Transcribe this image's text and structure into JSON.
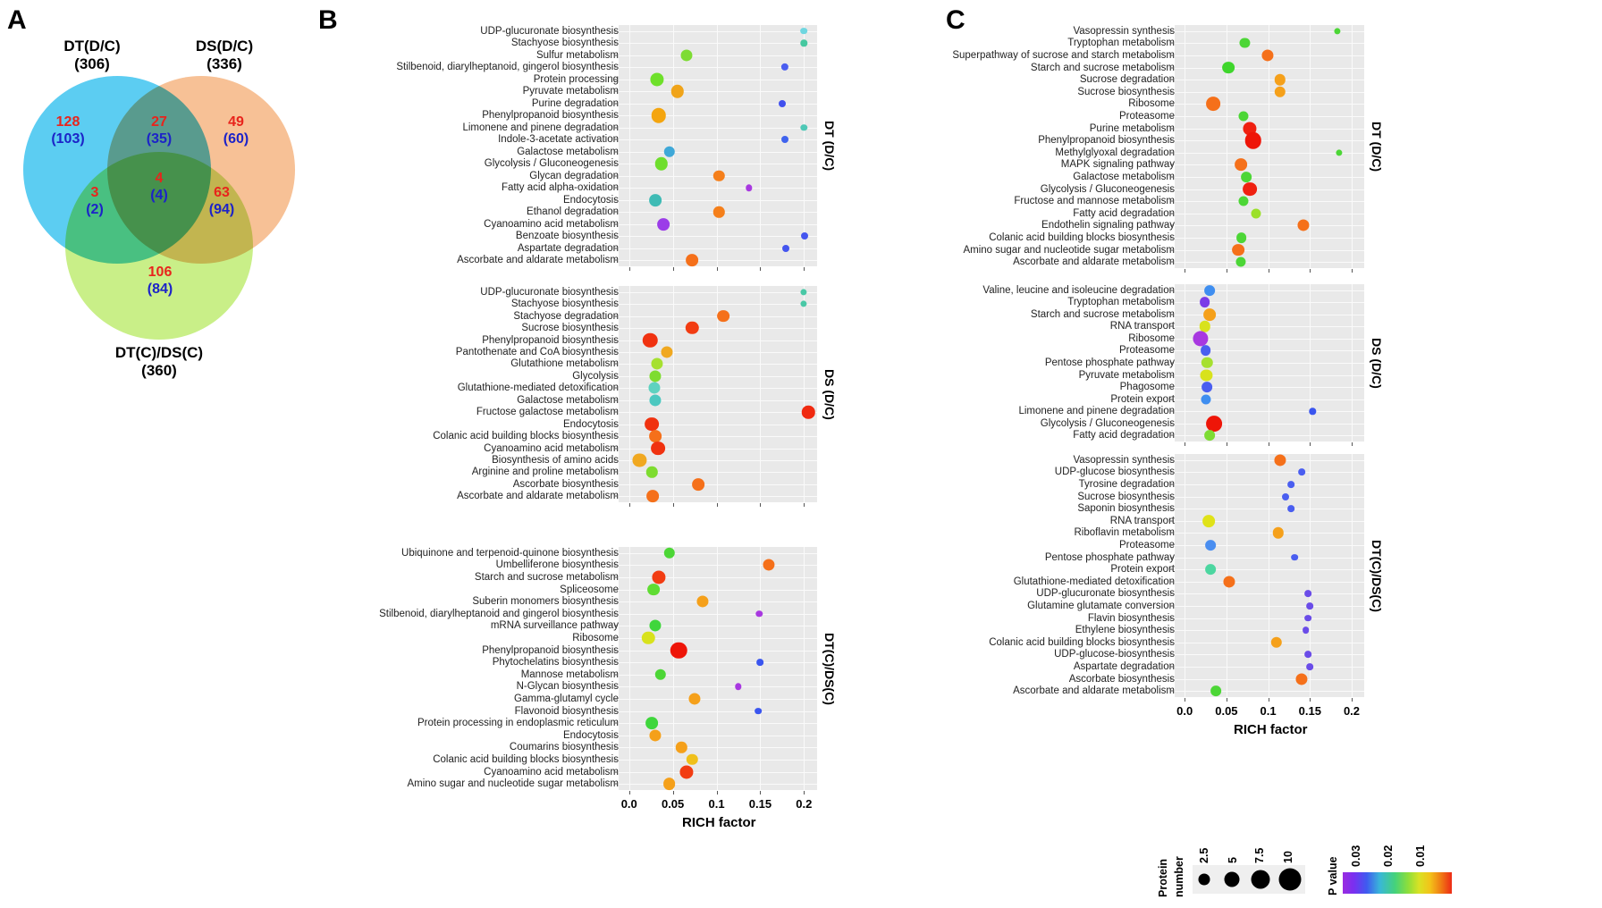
{
  "panels": {
    "a": "A",
    "b": "B",
    "c": "C"
  },
  "venn": {
    "sets": [
      {
        "name": "DT(D/C)",
        "count": "(306)",
        "color": "#5ccdf2"
      },
      {
        "name": "DS(D/C)",
        "count": "(336)",
        "color": "#f7c196"
      },
      {
        "name": "DT(C)/DS(C)",
        "count": "(360)",
        "color": "#c9ef88"
      }
    ],
    "regions": [
      {
        "id": "dt-only",
        "up": "128",
        "down": "(103)"
      },
      {
        "id": "dt-ds",
        "up": "27",
        "down": "(35)"
      },
      {
        "id": "ds-only",
        "up": "49",
        "down": "(60)"
      },
      {
        "id": "dt-dtds",
        "up": "3",
        "down": "(2)"
      },
      {
        "id": "center",
        "up": "4",
        "down": "(4)"
      },
      {
        "id": "ds-dtds",
        "up": "63",
        "down": "(94)"
      },
      {
        "id": "dtds-only",
        "up": "106",
        "down": "(84)"
      }
    ]
  },
  "axis": {
    "x_title": "RICH factor"
  },
  "legend": {
    "size_title_1": "Protein",
    "size_title_2": "number",
    "size_values": [
      "2.5",
      "5",
      "7.5",
      "10"
    ],
    "pvalue_title": "P value",
    "pvalue_ticks": [
      "0.03",
      "0.02",
      "0.01"
    ]
  },
  "chart_data": [
    {
      "id": "B-DT",
      "type": "scatter",
      "panel": "B",
      "strip": "DT (D/C)",
      "xlabel": "RICH factor",
      "xlim": [
        -0.012,
        0.215
      ],
      "xticks": [
        0.0,
        0.05,
        0.1,
        0.15,
        0.2
      ],
      "xticklabels": [
        "0.0",
        "0.05",
        "0.1",
        "0.15",
        "0.2"
      ],
      "grid": true,
      "categories": [
        "UDP-glucuronate biosynthesis",
        "Stachyose biosynthesis",
        "Sulfur metabolism",
        "Stilbenoid, diarylheptanoid, gingerol biosynthesis",
        "Protein processing",
        "Pyruvate metabolism",
        "Purine degradation",
        "Phenylpropanoid biosynthesis",
        "Limonene and pinene degradation",
        "Indole-3-acetate activation",
        "Galactose metabolism",
        "Glycolysis / Gluconeogenesis",
        "Glycan degradation",
        "Fatty acid alpha-oxidation",
        "Endocytosis",
        "Ethanol degradation",
        "Cyanoamino acid metabolism",
        "Benzoate biosynthesis",
        "Aspartate degradation",
        "Ascorbate and aldarate metabolism"
      ],
      "points": [
        {
          "x": 0.2,
          "size": 2.0,
          "color": "#6fd6e0"
        },
        {
          "x": 0.2,
          "size": 1.8,
          "color": "#46c8a0"
        },
        {
          "x": 0.066,
          "size": 6.0,
          "color": "#7ddc33"
        },
        {
          "x": 0.178,
          "size": 2.4,
          "color": "#4a5ef0"
        },
        {
          "x": 0.032,
          "size": 7.5,
          "color": "#6ee02a"
        },
        {
          "x": 0.055,
          "size": 7.0,
          "color": "#f0a41a"
        },
        {
          "x": 0.175,
          "size": 2.2,
          "color": "#4050ee"
        },
        {
          "x": 0.034,
          "size": 8.5,
          "color": "#f4a50f"
        },
        {
          "x": 0.2,
          "size": 1.8,
          "color": "#4ec8b6"
        },
        {
          "x": 0.178,
          "size": 2.2,
          "color": "#3f63ee"
        },
        {
          "x": 0.046,
          "size": 5.5,
          "color": "#3fa8d8"
        },
        {
          "x": 0.037,
          "size": 7.0,
          "color": "#6ede2c"
        },
        {
          "x": 0.103,
          "size": 5.5,
          "color": "#f57f1a"
        },
        {
          "x": 0.137,
          "size": 1.8,
          "color": "#a839e0"
        },
        {
          "x": 0.03,
          "size": 6.5,
          "color": "#3fbbb5"
        },
        {
          "x": 0.103,
          "size": 5.5,
          "color": "#f57f1a"
        },
        {
          "x": 0.039,
          "size": 6.5,
          "color": "#9b3ce8"
        },
        {
          "x": 0.201,
          "size": 2.2,
          "color": "#4455ef"
        },
        {
          "x": 0.179,
          "size": 2.2,
          "color": "#4455ef"
        },
        {
          "x": 0.072,
          "size": 6.5,
          "color": "#f5701a"
        }
      ]
    },
    {
      "id": "B-DS",
      "type": "scatter",
      "panel": "B",
      "strip": "DS (D/C)",
      "xlabel": "RICH factor",
      "xlim": [
        -0.012,
        0.215
      ],
      "xticks": [
        0.0,
        0.05,
        0.1,
        0.15,
        0.2
      ],
      "xticklabels": [
        "0.0",
        "0.05",
        "0.1",
        "0.15",
        "0.2"
      ],
      "grid": true,
      "categories": [
        "UDP-glucuronate biosynthesis",
        "Stachyose biosynthesis",
        "Stachyose degradation",
        "Sucrose biosynthesis",
        "Phenylpropanoid biosynthesis",
        "Pantothenate and CoA biosynthesis",
        "Glutathione metabolism",
        "Glycolysis",
        "Glutathione-mediated detoxification",
        "Galactose metabolism",
        "Fructose galactose metabolism",
        "Endocytosis",
        "Colanic acid building blocks biosynthesis",
        "Cyanoamino acid metabolism",
        "Biosynthesis of amino acids",
        "Arginine and proline metabolism",
        "Ascorbate biosynthesis",
        "Ascorbate and aldarate metabolism"
      ],
      "points": [
        {
          "x": 0.2,
          "size": 1.6,
          "color": "#49c8a6"
        },
        {
          "x": 0.2,
          "size": 1.6,
          "color": "#49c8a6"
        },
        {
          "x": 0.108,
          "size": 6.5,
          "color": "#f5701a"
        },
        {
          "x": 0.072,
          "size": 7.0,
          "color": "#f23c12"
        },
        {
          "x": 0.024,
          "size": 8.5,
          "color": "#f03210"
        },
        {
          "x": 0.043,
          "size": 6.0,
          "color": "#f0a820"
        },
        {
          "x": 0.032,
          "size": 6.0,
          "color": "#a6e030"
        },
        {
          "x": 0.03,
          "size": 6.0,
          "color": "#7edc30"
        },
        {
          "x": 0.029,
          "size": 6.0,
          "color": "#5fd2c0"
        },
        {
          "x": 0.03,
          "size": 6.0,
          "color": "#4cc8c0"
        },
        {
          "x": 0.205,
          "size": 7.0,
          "color": "#f02a10"
        },
        {
          "x": 0.026,
          "size": 8.0,
          "color": "#f03210"
        },
        {
          "x": 0.03,
          "size": 6.5,
          "color": "#f5701a"
        },
        {
          "x": 0.033,
          "size": 8.0,
          "color": "#f03210"
        },
        {
          "x": 0.012,
          "size": 7.5,
          "color": "#f0a820"
        },
        {
          "x": 0.026,
          "size": 5.5,
          "color": "#7edc30"
        },
        {
          "x": 0.079,
          "size": 6.5,
          "color": "#f5701a"
        },
        {
          "x": 0.027,
          "size": 6.5,
          "color": "#f5701a"
        }
      ]
    },
    {
      "id": "B-DTDS",
      "type": "scatter",
      "panel": "B",
      "strip": "DT(C)/DS(C)",
      "xlabel": "RICH factor",
      "xlim": [
        -0.012,
        0.215
      ],
      "xticks": [
        0.0,
        0.05,
        0.1,
        0.15,
        0.2
      ],
      "xticklabels": [
        "0.0",
        "0.05",
        "0.1",
        "0.15",
        "0.2"
      ],
      "grid": true,
      "categories": [
        "Ubiquinone and terpenoid-quinone biosynthesis",
        "Umbelliferone biosynthesis",
        "Starch and sucrose metabolism",
        "Spliceosome",
        "Suberin monomers biosynthesis",
        "Stilbenoid, diarylheptanoid and gingerol biosynthesis",
        "mRNA surveillance pathway",
        "Ribosome",
        "Phenylpropanoid biosynthesis",
        "Phytochelatins biosynthesis",
        "Mannose metabolism",
        "N-Glycan biosynthesis",
        "Gamma-glutamyl cycle",
        "Flavonoid biosynthesis",
        "Protein processing in endoplasmic reticulum",
        "Endocytosis",
        "Coumarins biosynthesis",
        "Colanic acid building blocks biosynthesis",
        "Cyanoamino acid metabolism",
        "Amino sugar and nucleotide sugar metabolism"
      ],
      "points": [
        {
          "x": 0.046,
          "size": 5.5,
          "color": "#4cd636"
        },
        {
          "x": 0.16,
          "size": 6.0,
          "color": "#f5701a"
        },
        {
          "x": 0.034,
          "size": 7.5,
          "color": "#f23c12"
        },
        {
          "x": 0.028,
          "size": 6.5,
          "color": "#5fdc32"
        },
        {
          "x": 0.084,
          "size": 6.0,
          "color": "#f5a01a"
        },
        {
          "x": 0.149,
          "size": 1.8,
          "color": "#a838e0"
        },
        {
          "x": 0.03,
          "size": 6.0,
          "color": "#3fd63c"
        },
        {
          "x": 0.022,
          "size": 7.0,
          "color": "#d8e21c"
        },
        {
          "x": 0.057,
          "size": 10.0,
          "color": "#ee1508"
        },
        {
          "x": 0.15,
          "size": 2.0,
          "color": "#3a55ef"
        },
        {
          "x": 0.036,
          "size": 5.5,
          "color": "#4cd636"
        },
        {
          "x": 0.125,
          "size": 1.8,
          "color": "#a838e0"
        },
        {
          "x": 0.075,
          "size": 6.0,
          "color": "#f5a01a"
        },
        {
          "x": 0.148,
          "size": 2.0,
          "color": "#3a55ef"
        },
        {
          "x": 0.026,
          "size": 6.5,
          "color": "#3fd63c"
        },
        {
          "x": 0.03,
          "size": 6.0,
          "color": "#f5a01a"
        },
        {
          "x": 0.06,
          "size": 5.5,
          "color": "#f5a01a"
        },
        {
          "x": 0.072,
          "size": 5.5,
          "color": "#f0c01a"
        },
        {
          "x": 0.066,
          "size": 7.5,
          "color": "#f23c12"
        },
        {
          "x": 0.046,
          "size": 6.5,
          "color": "#f5a01a"
        }
      ]
    },
    {
      "id": "C-DT",
      "type": "scatter",
      "panel": "C",
      "strip": "DT (D/C)",
      "xlabel": "RICH factor",
      "xlim": [
        -0.012,
        0.215
      ],
      "xticks": [
        0.0,
        0.05,
        0.1,
        0.15,
        0.2
      ],
      "xticklabels": [
        "0.0",
        "0.05",
        "0.1",
        "0.15",
        "0.2"
      ],
      "grid": true,
      "categories": [
        "Vasopressin synthesis",
        "Tryptophan metabolism",
        "Superpathway of sucrose and starch metabolism",
        "Starch and sucrose metabolism",
        "Sucrose degradation",
        "Sucrose biosynthesis",
        "Ribosome",
        "Proteasome",
        "Purine metabolism",
        "Phenylpropanoid biosynthesis",
        "Methylglyoxal degradation",
        "MAPK signaling pathway",
        "Galactose metabolism",
        "Glycolysis / Gluconeogenesis",
        "Fructose and mannose metabolism",
        "Fatty acid degradation",
        "Endothelin signaling pathway",
        "Colanic acid building blocks biosynthesis",
        "Amino sugar and nucleotide sugar metabolism",
        "Ascorbate and aldarate metabolism"
      ],
      "points": [
        {
          "x": 0.183,
          "size": 1.6,
          "color": "#4cd636"
        },
        {
          "x": 0.072,
          "size": 4.5,
          "color": "#4cd636"
        },
        {
          "x": 0.099,
          "size": 6.0,
          "color": "#f5701a"
        },
        {
          "x": 0.052,
          "size": 6.5,
          "color": "#3fd62c"
        },
        {
          "x": 0.114,
          "size": 5.5,
          "color": "#f5a01a"
        },
        {
          "x": 0.114,
          "size": 5.5,
          "color": "#f5a01a"
        },
        {
          "x": 0.034,
          "size": 8.0,
          "color": "#f5701a"
        },
        {
          "x": 0.07,
          "size": 4.5,
          "color": "#4cd636"
        },
        {
          "x": 0.078,
          "size": 7.5,
          "color": "#ef2010"
        },
        {
          "x": 0.082,
          "size": 10.0,
          "color": "#ee1508"
        },
        {
          "x": 0.185,
          "size": 1.6,
          "color": "#4cd636"
        },
        {
          "x": 0.067,
          "size": 6.5,
          "color": "#f5701a"
        },
        {
          "x": 0.074,
          "size": 5.0,
          "color": "#4cd636"
        },
        {
          "x": 0.078,
          "size": 8.0,
          "color": "#ef2010"
        },
        {
          "x": 0.07,
          "size": 4.5,
          "color": "#4cd636"
        },
        {
          "x": 0.085,
          "size": 4.5,
          "color": "#9be02a"
        },
        {
          "x": 0.142,
          "size": 6.0,
          "color": "#f5701a"
        },
        {
          "x": 0.068,
          "size": 5.0,
          "color": "#4cd636"
        },
        {
          "x": 0.064,
          "size": 6.5,
          "color": "#f5701a"
        },
        {
          "x": 0.067,
          "size": 4.5,
          "color": "#4cd636"
        }
      ]
    },
    {
      "id": "C-DS",
      "type": "scatter",
      "panel": "C",
      "strip": "DS (D/C)",
      "xlabel": "RICH factor",
      "xlim": [
        -0.012,
        0.215
      ],
      "xticks": [
        0.0,
        0.05,
        0.1,
        0.15,
        0.2
      ],
      "xticklabels": [
        "0.0",
        "0.05",
        "0.1",
        "0.15",
        "0.2"
      ],
      "grid": true,
      "categories": [
        "Valine, leucine and isoleucine degradation",
        "Tryptophan metabolism",
        "Starch and sucrose metabolism",
        "RNA transport",
        "Ribosome",
        "Proteasome",
        "Pentose phosphate pathway",
        "Pyruvate metabolism",
        "Phagosome",
        "Protein export",
        "Limonene and pinene degradation",
        "Glycolysis / Gluconeogenesis",
        "Fatty acid degradation"
      ],
      "points": [
        {
          "x": 0.03,
          "size": 5.0,
          "color": "#3f8ef0"
        },
        {
          "x": 0.024,
          "size": 5.0,
          "color": "#7a3ce8"
        },
        {
          "x": 0.03,
          "size": 6.5,
          "color": "#f5a01a"
        },
        {
          "x": 0.024,
          "size": 5.5,
          "color": "#d8e21c"
        },
        {
          "x": 0.019,
          "size": 9.0,
          "color": "#a838e0"
        },
        {
          "x": 0.025,
          "size": 5.0,
          "color": "#4a5ef0"
        },
        {
          "x": 0.027,
          "size": 5.5,
          "color": "#a6e030"
        },
        {
          "x": 0.026,
          "size": 6.0,
          "color": "#d8e21c"
        },
        {
          "x": 0.027,
          "size": 5.0,
          "color": "#4a5ef0"
        },
        {
          "x": 0.025,
          "size": 4.5,
          "color": "#3f8ef0"
        },
        {
          "x": 0.153,
          "size": 1.8,
          "color": "#3a55ef"
        },
        {
          "x": 0.035,
          "size": 9.5,
          "color": "#ee1508"
        },
        {
          "x": 0.03,
          "size": 5.0,
          "color": "#7ddc33"
        }
      ]
    },
    {
      "id": "C-DTDS",
      "type": "scatter",
      "panel": "C",
      "strip": "DT(C)/DS(C)",
      "xlabel": "RICH factor",
      "xlim": [
        -0.012,
        0.215
      ],
      "xticks": [
        0.0,
        0.05,
        0.1,
        0.15,
        0.2
      ],
      "xticklabels": [
        "0.0",
        "0.05",
        "0.1",
        "0.15",
        "0.2"
      ],
      "grid": true,
      "categories": [
        "Vasopressin synthesis",
        "UDP-glucose biosynthesis",
        "Tyrosine degradation",
        "Sucrose biosynthesis",
        "Saponin biosynthesis",
        "RNA transport",
        "Riboflavin metabolism",
        "Proteasome",
        "Pentose phosphate pathway",
        "Protein export",
        "Glutathione-mediated detoxification",
        "UDP-glucuronate biosynthesis",
        "Glutamine glutamate conversion",
        "Flavin biosynthesis",
        "Ethylene biosynthesis",
        "Colanic acid building blocks biosynthesis",
        "UDP-glucose-biosynthesis",
        "Aspartate degradation",
        "Ascorbate biosynthesis",
        "Ascorbate and aldarate metabolism"
      ],
      "points": [
        {
          "x": 0.114,
          "size": 6.0,
          "color": "#f5701a"
        },
        {
          "x": 0.14,
          "size": 2.0,
          "color": "#4a5ef0"
        },
        {
          "x": 0.127,
          "size": 2.0,
          "color": "#4a5ef0"
        },
        {
          "x": 0.121,
          "size": 2.2,
          "color": "#4a5ef0"
        },
        {
          "x": 0.127,
          "size": 2.0,
          "color": "#4a5ef0"
        },
        {
          "x": 0.029,
          "size": 6.5,
          "color": "#e0e218"
        },
        {
          "x": 0.112,
          "size": 5.5,
          "color": "#f5a01a"
        },
        {
          "x": 0.031,
          "size": 5.0,
          "color": "#4a8ef0"
        },
        {
          "x": 0.132,
          "size": 2.0,
          "color": "#4a5ef0"
        },
        {
          "x": 0.031,
          "size": 5.0,
          "color": "#4cd6a0"
        },
        {
          "x": 0.053,
          "size": 6.0,
          "color": "#f5701a"
        },
        {
          "x": 0.148,
          "size": 2.0,
          "color": "#6a4ce8"
        },
        {
          "x": 0.15,
          "size": 2.0,
          "color": "#6a4ce8"
        },
        {
          "x": 0.148,
          "size": 2.0,
          "color": "#6a4ce8"
        },
        {
          "x": 0.145,
          "size": 2.0,
          "color": "#6a4ce8"
        },
        {
          "x": 0.11,
          "size": 5.5,
          "color": "#f5a01a"
        },
        {
          "x": 0.148,
          "size": 2.0,
          "color": "#6a4ce8"
        },
        {
          "x": 0.15,
          "size": 2.0,
          "color": "#6a4ce8"
        },
        {
          "x": 0.14,
          "size": 6.0,
          "color": "#f5701a"
        },
        {
          "x": 0.037,
          "size": 5.0,
          "color": "#4cd636"
        }
      ]
    }
  ]
}
